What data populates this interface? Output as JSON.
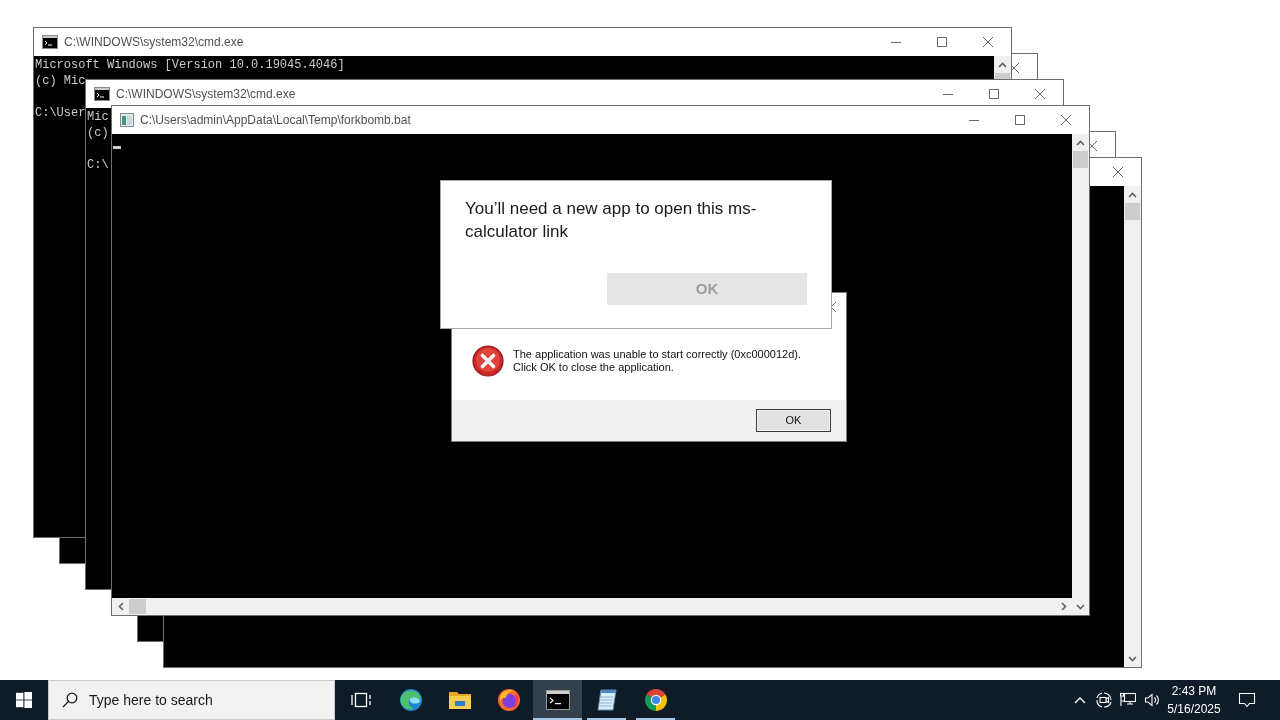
{
  "desktop": {
    "windows": [
      {
        "title": "C:\\WINDOWS\\system32\\cmd.exe",
        "banner": [
          "Microsoft Windows [Version 10.0.19045.4046]",
          "(c) Mic"
        ],
        "prompt": "C:\\User",
        "controls": [
          {
            "kind": "minimize"
          },
          {
            "kind": "maximize"
          },
          {
            "kind": "close"
          }
        ],
        "scrollbars": [
          {
            "kind": "vertical"
          }
        ]
      },
      {
        "controls": [
          {
            "kind": "close"
          }
        ]
      },
      {
        "title": "C:\\WINDOWS\\system32\\cmd.exe",
        "banner": [
          "Mic",
          "(c)"
        ],
        "prompt": "C:\\",
        "controls": [
          {
            "kind": "minimize"
          },
          {
            "kind": "maximize"
          },
          {
            "kind": "close"
          }
        ]
      },
      {
        "title": "C:\\Users\\admin\\AppData\\Local\\Temp\\forkbomb.bat",
        "cursor": true,
        "controls": [
          {
            "kind": "minimize"
          },
          {
            "kind": "maximize"
          },
          {
            "kind": "close"
          }
        ],
        "scrollbars": [
          {
            "kind": "vertical"
          },
          {
            "kind": "horizontal"
          }
        ]
      },
      {
        "controls": [
          {
            "kind": "close"
          }
        ]
      },
      {
        "controls": [
          {
            "kind": "close"
          }
        ],
        "scrollbars": [
          {
            "kind": "vertical"
          }
        ]
      }
    ],
    "dialogs": [
      {
        "kind": "prompt",
        "heading": "You’ll need a new app to open this ms-calculator link",
        "button": "OK"
      },
      {
        "kind": "error",
        "controls": [
          {
            "kind": "close"
          }
        ],
        "message": [
          "The application was unable to start correctly (0xc000012d).",
          "Click OK to close the application."
        ],
        "button": "OK"
      }
    ]
  },
  "taskbar": {
    "search": {
      "placeholder": "Type here to search"
    },
    "apps": [
      {
        "kind": "task_view",
        "selected": false,
        "running": false
      },
      {
        "kind": "edge",
        "selected": false,
        "running": false
      },
      {
        "kind": "explorer",
        "selected": false,
        "running": false
      },
      {
        "kind": "firefox",
        "selected": false,
        "running": false
      },
      {
        "kind": "terminal",
        "selected": true,
        "running": true
      },
      {
        "kind": "notepad",
        "selected": false,
        "running": true
      },
      {
        "kind": "chrome",
        "selected": false,
        "running": true
      }
    ],
    "clock": {
      "time": "2:43 PM",
      "date": "5/16/2025"
    }
  }
}
